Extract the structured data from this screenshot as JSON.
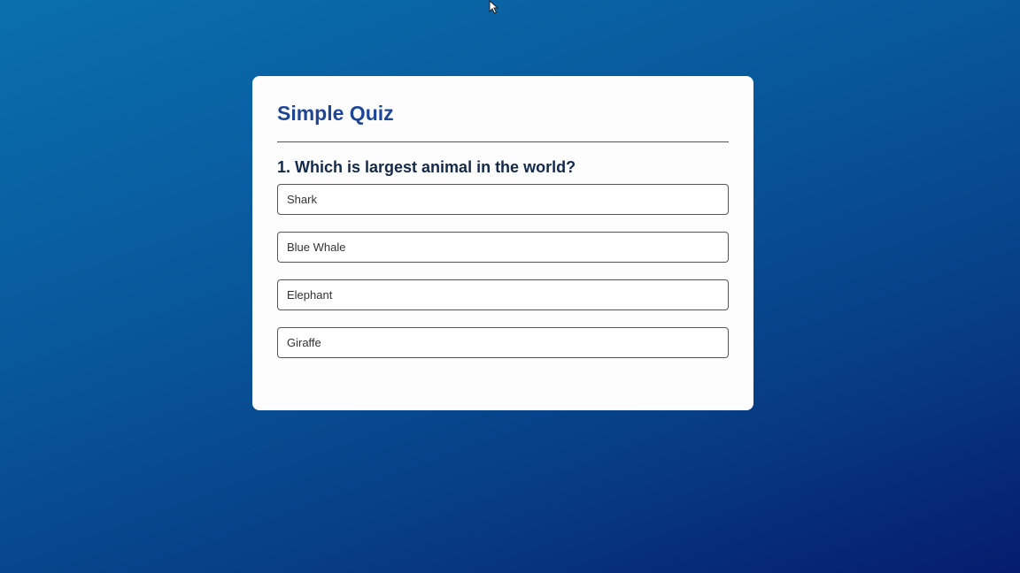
{
  "quiz": {
    "title": "Simple Quiz",
    "question": "1. Which is largest animal in the world?",
    "answers": [
      {
        "label": "Shark"
      },
      {
        "label": "Blue Whale"
      },
      {
        "label": "Elephant"
      },
      {
        "label": "Giraffe"
      }
    ]
  },
  "colors": {
    "title": "#1f4596",
    "question": "#13294b",
    "background_start": "#0a6fad",
    "background_end": "#061c6e"
  },
  "icons": {
    "cursor": "mouse-pointer-icon"
  }
}
